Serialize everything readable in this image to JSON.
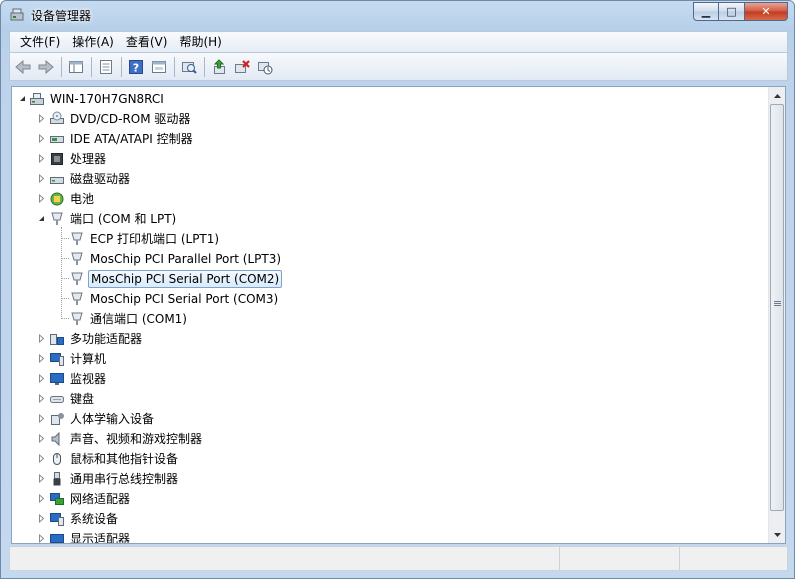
{
  "window": {
    "title": "设备管理器"
  },
  "caption": {
    "minimize": "▁",
    "maximize": "□",
    "close": "✕"
  },
  "menu": [
    {
      "label": "文件(F)"
    },
    {
      "label": "操作(A)"
    },
    {
      "label": "查看(V)"
    },
    {
      "label": "帮助(H)"
    }
  ],
  "toolbar": {
    "buttons": [
      "back-icon",
      "forward-icon",
      "show-hide-tree-icon",
      "properties-icon",
      "help-icon",
      "view-icon",
      "scan-hardware-icon",
      "update-driver-icon",
      "uninstall-icon",
      "disable-icon"
    ]
  },
  "tree": {
    "root": "WIN-170H7GN8RCI",
    "items": [
      {
        "label": "DVD/CD-ROM 驱动器",
        "icon": "dvd-drive-icon",
        "expanded": false
      },
      {
        "label": "IDE ATA/ATAPI 控制器",
        "icon": "ide-controller-icon",
        "expanded": false
      },
      {
        "label": "处理器",
        "icon": "processor-icon",
        "expanded": false
      },
      {
        "label": "磁盘驱动器",
        "icon": "disk-drive-icon",
        "expanded": false
      },
      {
        "label": "电池",
        "icon": "battery-icon",
        "expanded": false
      },
      {
        "label": "端口 (COM 和 LPT)",
        "icon": "port-icon",
        "expanded": true
      },
      {
        "label": "ECP 打印机端口 (LPT1)",
        "icon": "port-icon",
        "child": true
      },
      {
        "label": "MosChip PCI Parallel Port (LPT3)",
        "icon": "port-icon",
        "child": true
      },
      {
        "label": "MosChip PCI Serial Port (COM2)",
        "icon": "port-icon",
        "child": true,
        "selected": true
      },
      {
        "label": "MosChip PCI Serial Port (COM3)",
        "icon": "port-icon",
        "child": true
      },
      {
        "label": "通信端口 (COM1)",
        "icon": "port-icon",
        "child": true
      },
      {
        "label": "多功能适配器",
        "icon": "multifunction-icon",
        "expanded": false
      },
      {
        "label": "计算机",
        "icon": "computer-icon",
        "expanded": false
      },
      {
        "label": "监视器",
        "icon": "monitor-icon",
        "expanded": false
      },
      {
        "label": "键盘",
        "icon": "keyboard-icon",
        "expanded": false
      },
      {
        "label": "人体学输入设备",
        "icon": "hid-icon",
        "expanded": false
      },
      {
        "label": "声音、视频和游戏控制器",
        "icon": "sound-icon",
        "expanded": false
      },
      {
        "label": "鼠标和其他指针设备",
        "icon": "mouse-icon",
        "expanded": false
      },
      {
        "label": "通用串行总线控制器",
        "icon": "usb-icon",
        "expanded": false
      },
      {
        "label": "网络适配器",
        "icon": "network-icon",
        "expanded": false
      },
      {
        "label": "系统设备",
        "icon": "system-icon",
        "expanded": false
      },
      {
        "label": "显示适配器",
        "icon": "display-adapter-icon",
        "expanded": false
      }
    ]
  },
  "colors": {
    "selection_border": "#7da2ce",
    "selection_bg": "#d9ebfb",
    "frame": "#b5cfe9"
  }
}
